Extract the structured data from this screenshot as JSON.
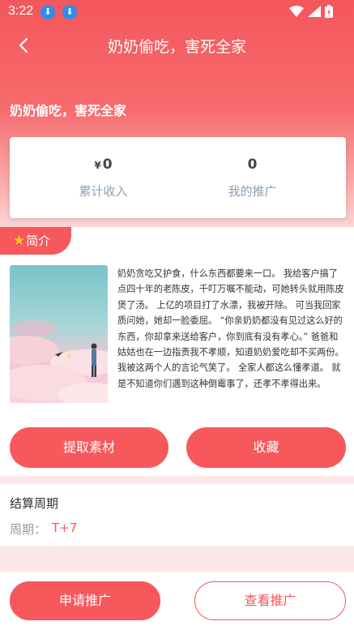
{
  "status_bar": {
    "time": "3:22"
  },
  "nav": {
    "title": "奶奶偷吃，害死全家"
  },
  "hero": {
    "title": "奶奶偷吃，害死全家"
  },
  "stats": [
    {
      "currency": "¥",
      "value": "0",
      "label": "累计收入"
    },
    {
      "value": "0",
      "label": "我的推广"
    }
  ],
  "intro": {
    "tab_label": "简介",
    "description": "奶奶贪吃又护食，什么东西都要来一口。 我给客户搞了点四十年的老陈皮，千叮万嘱不能动，可她转头就用陈皮煲了汤。 上亿的项目打了水漂，我被开除。 可当我回家质问她，她却一脸委屈。 “你亲奶奶都没有见过这么好的东西，你却拿来送给客户，你到底有没有孝心。” 爸爸和姑姑也在一边指责我不孝顺，知道奶奶爱吃却不买两份。 我被这两个人的言论气笑了。 全家人都这么懂孝道。 就是不知道你们遇到这种倒霉事了，还孝不孝得出来。"
  },
  "actions": {
    "extract": "提取素材",
    "favorite": "收藏"
  },
  "settlement": {
    "title": "结算周期",
    "period_label": "周期：",
    "period_value": "T+7"
  },
  "bottom": {
    "apply": "申请推广",
    "view": "查看推广"
  },
  "colors": {
    "accent": "#f6585c",
    "page_bg": "#fde8e8"
  }
}
